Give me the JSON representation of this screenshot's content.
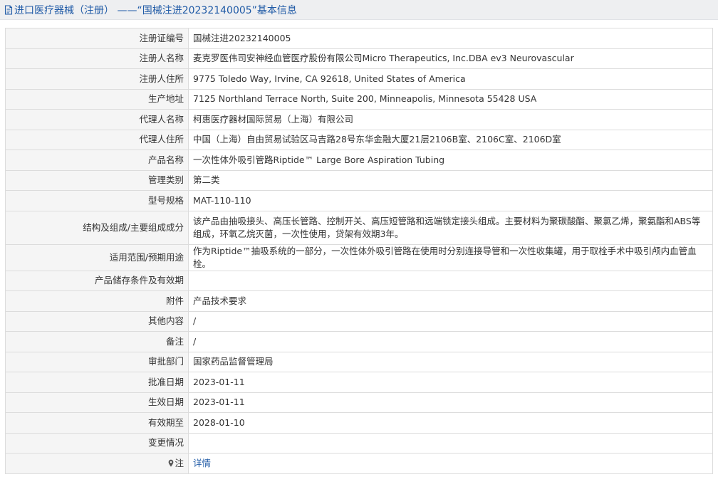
{
  "header": {
    "title": "进口医疗器械（注册） ——“国械注进20232140005”基本信息",
    "icon": "document-icon"
  },
  "rows": [
    {
      "label": "注册证编号",
      "value": "国械注进20232140005"
    },
    {
      "label": "注册人名称",
      "value": "麦克罗医伟司安神经血管医疗股份有限公司Micro Therapeutics, Inc.DBA ev3 Neurovascular"
    },
    {
      "label": "注册人住所",
      "value": "9775 Toledo Way, Irvine, CA 92618, United States of America"
    },
    {
      "label": "生产地址",
      "value": "7125 Northland Terrace North, Suite 200, Minneapolis, Minnesota 55428 USA"
    },
    {
      "label": "代理人名称",
      "value": "柯惠医疗器材国际贸易（上海）有限公司"
    },
    {
      "label": "代理人住所",
      "value": "中国（上海）自由贸易试验区马吉路28号东华金融大厦21层2106B室、2106C室、2106D室"
    },
    {
      "label": "产品名称",
      "value": "一次性体外吸引管路Riptide™ Large Bore Aspiration Tubing"
    },
    {
      "label": "管理类别",
      "value": "第二类"
    },
    {
      "label": "型号规格",
      "value": "MAT-110-110"
    },
    {
      "label": "结构及组成/主要组成成分",
      "value": "该产品由抽吸接头、高压长管路、控制开关、高压短管路和远端锁定接头组成。主要材料为聚碳酸酯、聚氯乙烯，聚氨酯和ABS等组成，环氧乙烷灭菌，一次性使用，贷架有效期3年。"
    },
    {
      "label": "适用范围/预期用途",
      "value": "作为Riptide™抽吸系统的一部分，一次性体外吸引管路在使用时分别连接导管和一次性收集罐，用于取栓手术中吸引颅内血管血栓。"
    },
    {
      "label": "产品储存条件及有效期",
      "value": ""
    },
    {
      "label": "附件",
      "value": "产品技术要求"
    },
    {
      "label": "其他内容",
      "value": "/"
    },
    {
      "label": "备注",
      "value": "/"
    },
    {
      "label": "审批部门",
      "value": "国家药品监督管理局"
    },
    {
      "label": "批准日期",
      "value": "2023-01-11"
    },
    {
      "label": "生效日期",
      "value": "2023-01-11"
    },
    {
      "label": "有效期至",
      "value": "2028-01-10"
    },
    {
      "label": "变更情况",
      "value": ""
    }
  ],
  "note_row": {
    "label": "注",
    "icon": "pin-icon",
    "link_text": "详情"
  },
  "colors": {
    "link": "#1f5aa6",
    "label_bg": "#f5f5f5",
    "border": "#dcdcdc",
    "header_bg": "#eeeff1"
  }
}
